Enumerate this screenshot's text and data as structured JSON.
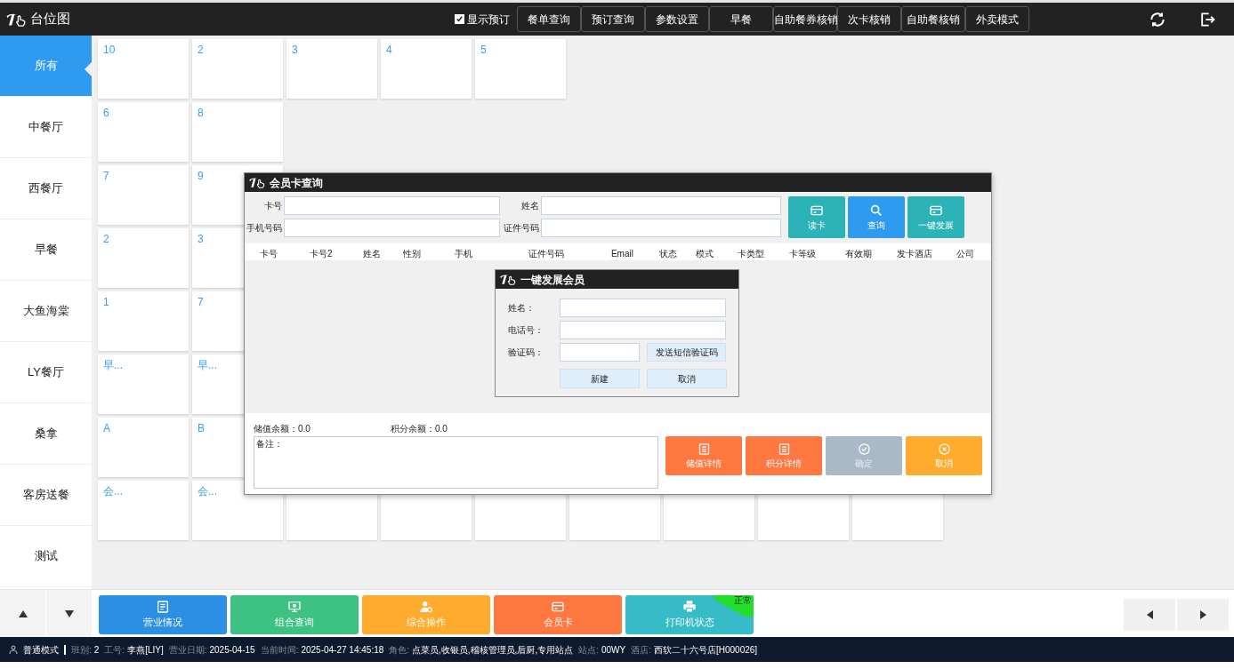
{
  "header": {
    "title": "台位图",
    "show_reservation": {
      "label": "显示预订",
      "checked": true
    },
    "buttons": [
      "餐单查询",
      "预订查询",
      "参数设置",
      "早餐",
      "自助餐券核销",
      "次卡核销",
      "自助餐核销",
      "外卖模式"
    ]
  },
  "sidebar": {
    "items": [
      {
        "label": "所有",
        "selected": true
      },
      {
        "label": "中餐厅",
        "selected": false
      },
      {
        "label": "西餐厅",
        "selected": false
      },
      {
        "label": "早餐",
        "selected": false
      },
      {
        "label": "大鱼海棠",
        "selected": false
      },
      {
        "label": "LY餐厅",
        "selected": false
      },
      {
        "label": "桑拿",
        "selected": false
      },
      {
        "label": "客房送餐",
        "selected": false
      },
      {
        "label": "测试",
        "selected": false
      }
    ]
  },
  "table_grid": [
    {
      "cards": [
        {
          "kind": "table",
          "label": "10"
        },
        {
          "kind": "table",
          "label": "2"
        },
        {
          "kind": "table",
          "label": "3"
        },
        {
          "kind": "table",
          "label": "4"
        },
        {
          "kind": "table",
          "label": "5"
        }
      ]
    },
    {
      "cards": [
        {
          "kind": "table",
          "label": "6"
        },
        {
          "kind": "table",
          "label": "8"
        }
      ]
    },
    {
      "cards": [
        {
          "kind": "table",
          "label": "7"
        },
        {
          "kind": "table",
          "label": "9"
        }
      ]
    },
    {
      "cards": [
        {
          "kind": "table",
          "label": "2"
        },
        {
          "kind": "table",
          "label": "3"
        }
      ]
    },
    {
      "cards": [
        {
          "kind": "table",
          "label": "1"
        },
        {
          "kind": "table",
          "label": "7"
        }
      ]
    },
    {
      "cards": [
        {
          "kind": "table",
          "label": "早..."
        },
        {
          "kind": "table",
          "label": "早..."
        }
      ]
    },
    {
      "cards": [
        {
          "kind": "table",
          "label": "A"
        },
        {
          "kind": "table",
          "label": "B"
        }
      ]
    },
    {
      "cards": [
        {
          "kind": "table",
          "label": "会..."
        },
        {
          "kind": "table",
          "label": "会..."
        },
        {
          "kind": "blank"
        },
        {
          "kind": "blank"
        },
        {
          "kind": "blank"
        },
        {
          "kind": "blank"
        },
        {
          "kind": "blank"
        },
        {
          "kind": "blank"
        },
        {
          "kind": "blank"
        }
      ]
    }
  ],
  "member_dialog": {
    "title": "会员卡查询",
    "fields_left": [
      {
        "label": "卡号"
      },
      {
        "label": "手机号码"
      }
    ],
    "fields_right": [
      {
        "label": "姓名"
      },
      {
        "label": "证件号码"
      }
    ],
    "actions": [
      {
        "label": "读卡",
        "kind": "card",
        "color": "#2bb3b8"
      },
      {
        "label": "查询",
        "kind": "search",
        "color": "#2f9bf0"
      },
      {
        "label": "一键发展",
        "kind": "card",
        "color": "#2bb3b8"
      }
    ],
    "columns": [
      "卡号",
      "卡号2",
      "姓名",
      "性别",
      "手机",
      "证件号码",
      "Email",
      "状态",
      "模式",
      "卡类型",
      "卡等级",
      "有效期",
      "发卡酒店",
      "公司"
    ],
    "balances": [
      {
        "label": "储值余额：",
        "value": "0.0"
      },
      {
        "label": "积分余额：",
        "value": "0.0"
      }
    ],
    "remark_label": "备注：",
    "buttons": [
      {
        "label": "储值详情",
        "kind": "list",
        "color": "#ff7842",
        "disabled": false
      },
      {
        "label": "积分详情",
        "kind": "list",
        "color": "#ff7842",
        "disabled": false
      },
      {
        "label": "确定",
        "kind": "check",
        "color": "#aab9c8",
        "disabled": true
      },
      {
        "label": "取消",
        "kind": "cancel",
        "color": "#ffab2e",
        "disabled": false
      }
    ]
  },
  "quick_member_dialog": {
    "title": "一键发展会员",
    "fields": [
      {
        "label": "姓名：",
        "kind": "text"
      },
      {
        "label": "电话号：",
        "kind": "text"
      },
      {
        "label": "验证码：",
        "kind": "code"
      }
    ],
    "send_code": "发送短信验证码",
    "buttons": [
      "新建",
      "取消"
    ]
  },
  "bottom_toolbar": {
    "buttons": [
      {
        "label": "营业情况",
        "kind": "report",
        "color": "#2b8fe3"
      },
      {
        "label": "组合查询",
        "kind": "monitor",
        "color": "#3dc282"
      },
      {
        "label": "综合操作",
        "kind": "person",
        "color": "#ffab2e"
      },
      {
        "label": "会员卡",
        "kind": "card",
        "color": "#ff7842"
      },
      {
        "label": "打印机状态",
        "kind": "printer",
        "color": "#36bcc6",
        "badge": "正常"
      }
    ]
  },
  "status_bar": {
    "mode": "普通模式",
    "items": [
      {
        "label": "班别:",
        "value": "2"
      },
      {
        "label": "工号:",
        "value": "李燕[LIY]"
      },
      {
        "label": "营业日期:",
        "value": "2025-04-15"
      },
      {
        "label": "当前时间:",
        "value": "2025-04-27 14:45:18"
      },
      {
        "label": "角色:",
        "value": "点菜员,收银员,稽核管理员,后厨,专用站点"
      },
      {
        "label": "站点:",
        "value": "00WY"
      },
      {
        "label": "酒店:",
        "value": "西软二十六号店[H000026]"
      }
    ]
  }
}
